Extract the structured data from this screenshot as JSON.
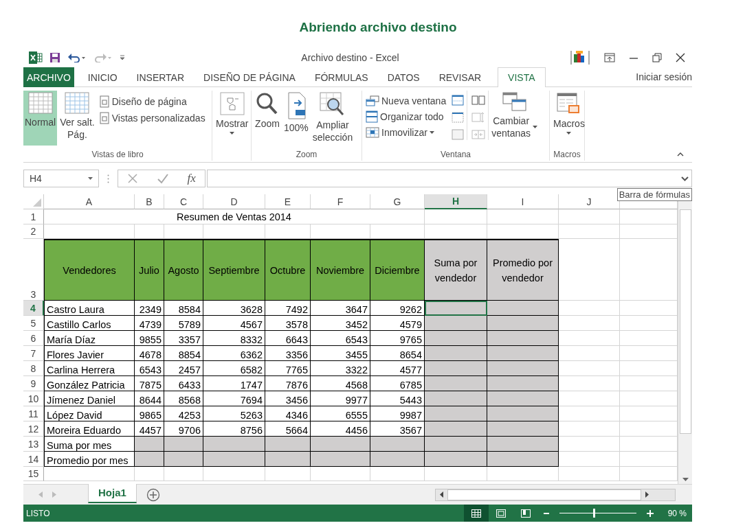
{
  "page_title": "Abriendo archivo destino",
  "window": {
    "title": "Archivo destino - Excel",
    "sign_in": "Iniciar sesión"
  },
  "tabs": [
    {
      "label": "ARCHIVO",
      "kind": "file",
      "selected": false
    },
    {
      "label": "INICIO",
      "kind": "tab",
      "selected": false
    },
    {
      "label": "INSERTAR",
      "kind": "tab",
      "selected": false
    },
    {
      "label": "DISEÑO DE PÁGINA",
      "kind": "tab",
      "selected": false
    },
    {
      "label": "FÓRMULAS",
      "kind": "tab",
      "selected": false
    },
    {
      "label": "DATOS",
      "kind": "tab",
      "selected": false
    },
    {
      "label": "REVISAR",
      "kind": "tab",
      "selected": false
    },
    {
      "label": "VISTA",
      "kind": "tab",
      "selected": true
    }
  ],
  "ribbon": {
    "groups": [
      {
        "label": "Vistas de libro",
        "items": [
          {
            "label": "Normal",
            "selected": true
          },
          {
            "label": "Ver salt.\nPág.",
            "selected": false
          },
          {
            "label": "Diseño de página",
            "selected": false
          },
          {
            "label": "Vistas personalizadas",
            "selected": false
          }
        ]
      },
      {
        "items": [
          {
            "label": "Mostrar"
          }
        ]
      },
      {
        "label": "Zoom",
        "items": [
          {
            "label": "Zoom"
          },
          {
            "label": "100%"
          },
          {
            "label": "Ampliar\nselección"
          }
        ]
      },
      {
        "label": "Ventana",
        "items": [
          {
            "label": "Nueva ventana"
          },
          {
            "label": "Organizar todo"
          },
          {
            "label": "Inmovilizar"
          },
          {
            "label": "Cambiar\nventanas"
          }
        ]
      },
      {
        "label": "Macros",
        "items": [
          {
            "label": "Macros"
          }
        ]
      }
    ]
  },
  "formula_bar": {
    "name_box": "H4",
    "function_label": "fx",
    "tooltip": "Barra de fórmulas"
  },
  "sheet": {
    "columns": [
      {
        "label": "A",
        "selected": false
      },
      {
        "label": "B",
        "selected": false
      },
      {
        "label": "C",
        "selected": false
      },
      {
        "label": "D",
        "selected": false
      },
      {
        "label": "E",
        "selected": false
      },
      {
        "label": "F",
        "selected": false
      },
      {
        "label": "G",
        "selected": false
      },
      {
        "label": "H",
        "selected": true
      },
      {
        "label": "I",
        "selected": false
      },
      {
        "label": "J",
        "selected": false
      }
    ],
    "row_numbers": [
      {
        "label": "1",
        "selected": false
      },
      {
        "label": "2",
        "selected": false
      },
      {
        "label": "3",
        "selected": false
      },
      {
        "label": "4",
        "selected": true
      },
      {
        "label": "5",
        "selected": false
      },
      {
        "label": "6",
        "selected": false
      },
      {
        "label": "7",
        "selected": false
      },
      {
        "label": "8",
        "selected": false
      },
      {
        "label": "9",
        "selected": false
      },
      {
        "label": "10",
        "selected": false
      },
      {
        "label": "11",
        "selected": false
      },
      {
        "label": "12",
        "selected": false
      },
      {
        "label": "13",
        "selected": false
      },
      {
        "label": "14",
        "selected": false
      },
      {
        "label": "15",
        "selected": false
      }
    ],
    "title": "Resumen de Ventas 2014",
    "header": [
      "Vendedores",
      "Julio",
      "Agosto",
      "Septiembre",
      "Octubre",
      "Noviembre",
      "Diciembre",
      "Suma por vendedor",
      "Promedio por vendedor"
    ],
    "rows": [
      {
        "name": "Castro Laura",
        "values": [
          "2349",
          "8584",
          "3628",
          "7492",
          "3647",
          "9262"
        ]
      },
      {
        "name": "Castillo Carlos",
        "values": [
          "4739",
          "5789",
          "4567",
          "3578",
          "3452",
          "4579"
        ]
      },
      {
        "name": "María Díaz",
        "values": [
          "9855",
          "3357",
          "8332",
          "6643",
          "6543",
          "9765"
        ]
      },
      {
        "name": "Flores Javier",
        "values": [
          "4678",
          "8854",
          "6362",
          "3356",
          "3455",
          "8654"
        ]
      },
      {
        "name": "Carlina Herrera",
        "values": [
          "6543",
          "2457",
          "6582",
          "7765",
          "3322",
          "4577"
        ]
      },
      {
        "name": "González Patricia",
        "values": [
          "7875",
          "6433",
          "1747",
          "7876",
          "4568",
          "6785"
        ]
      },
      {
        "name": "Jímenez Daniel",
        "values": [
          "8644",
          "8568",
          "7694",
          "3456",
          "9977",
          "5443"
        ]
      },
      {
        "name": "López David",
        "values": [
          "9865",
          "4253",
          "5263",
          "4346",
          "6555",
          "9987"
        ]
      },
      {
        "name": "Moreira Eduardo",
        "values": [
          "4457",
          "9706",
          "8756",
          "5664",
          "4456",
          "3567"
        ]
      }
    ],
    "footer": [
      "Suma por mes",
      "Promedio por mes"
    ]
  },
  "sheet_tabs": [
    {
      "label": "Hoja1",
      "selected": true
    }
  ],
  "status_bar": {
    "status": "LISTO",
    "views": [
      {
        "selected": true
      },
      {
        "selected": false
      },
      {
        "selected": false
      }
    ],
    "zoom": {
      "level": 0.45,
      "reading": "90 %"
    }
  }
}
